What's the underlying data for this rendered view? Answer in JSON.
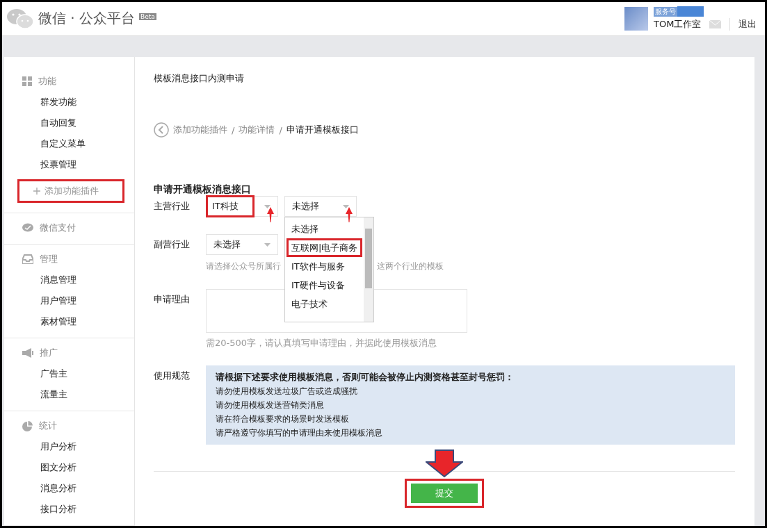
{
  "header": {
    "logo_title": "微信 · 公众平台",
    "beta": "Beta",
    "account_type": "服务号",
    "account_name": "TOM工作室",
    "logout": "退出"
  },
  "sidebar": {
    "groups": [
      {
        "kind": "grid",
        "title": "功能",
        "items": [
          {
            "label": "群发功能"
          },
          {
            "label": "自动回复"
          },
          {
            "label": "自定义菜单"
          },
          {
            "label": "投票管理"
          }
        ],
        "add_plugin": {
          "label": "添加功能插件",
          "highlighted": true
        }
      },
      {
        "kind": "chat",
        "title": "微信支付"
      },
      {
        "kind": "inbox",
        "title": "管理",
        "items": [
          {
            "label": "消息管理"
          },
          {
            "label": "用户管理"
          },
          {
            "label": "素材管理"
          }
        ]
      },
      {
        "kind": "megaphone",
        "title": "推广",
        "items": [
          {
            "label": "广告主"
          },
          {
            "label": "流量主"
          }
        ]
      },
      {
        "kind": "pie",
        "title": "统计",
        "items": [
          {
            "label": "用户分析"
          },
          {
            "label": "图文分析"
          },
          {
            "label": "消息分析"
          },
          {
            "label": "接口分析"
          }
        ]
      }
    ]
  },
  "main": {
    "page_title": "模板消息接口内测申请",
    "breadcrumb": {
      "separator": "/",
      "items": [
        {
          "label": "添加功能插件",
          "current": false
        },
        {
          "label": "功能详情",
          "current": false
        },
        {
          "label": "申请开通模板接口",
          "current": true
        }
      ]
    },
    "form": {
      "heading": "申请开通模板消息接口",
      "primary": {
        "label": "主营行业",
        "selects": [
          {
            "value": "IT科技",
            "highlighted": true,
            "open": false,
            "arrow": true
          },
          {
            "value": "未选择",
            "highlighted": false,
            "open": true,
            "arrow": true
          }
        ],
        "options": [
          {
            "label": "未选择",
            "highlighted": false
          },
          {
            "label": "互联网|电子商务",
            "highlighted": true
          },
          {
            "label": "IT软件与服务",
            "highlighted": false
          },
          {
            "label": "IT硬件与设备",
            "highlighted": false
          },
          {
            "label": "电子技术",
            "highlighted": false
          }
        ]
      },
      "secondary": {
        "label": "副营行业",
        "select": "未选择",
        "hint_parts": [
          "请选择公众号所属行",
          "这两个行业的模板"
        ]
      },
      "reason": {
        "label": "申请理由",
        "hint": "需20-500字，请认真填写申请理由，并据此使用模板消息"
      },
      "rules": {
        "label": "使用规范",
        "title": "请根据下述要求使用模板消息，否则可能会被停止内测资格甚至封号惩罚：",
        "lines": [
          "请勿使用模板发送垃圾广告或造成骚扰",
          "请勿使用模板发送营销类消息",
          "请在符合模板要求的场景时发送模板",
          "请严格遵守你填写的申请理由来使用模板消息"
        ]
      },
      "submit": {
        "label": "提交",
        "highlighted": true,
        "arrow": true
      }
    }
  }
}
